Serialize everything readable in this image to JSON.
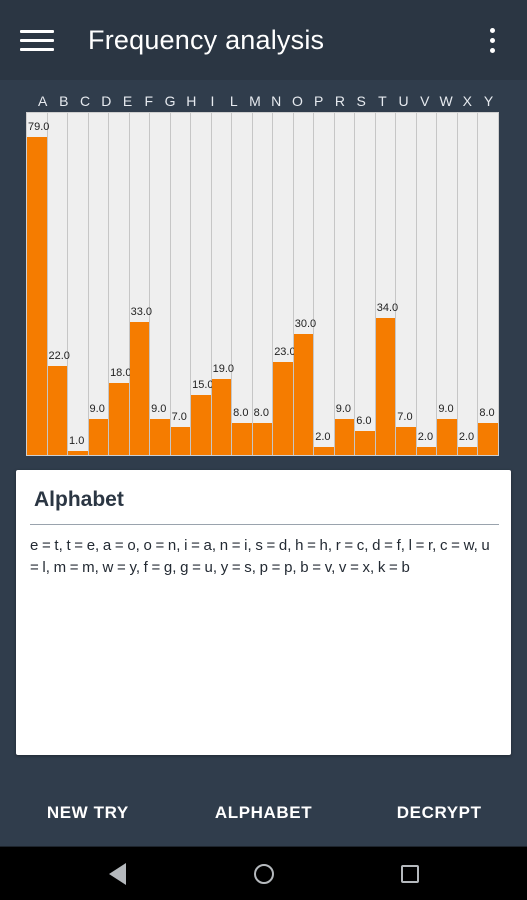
{
  "appbar": {
    "title": "Frequency analysis",
    "menu_icon": "hamburger-menu-icon",
    "overflow_icon": "more-vert-icon"
  },
  "chart_data": {
    "type": "bar",
    "title": "",
    "xlabel": "",
    "ylabel": "",
    "ylim": [
      0,
      79
    ],
    "grid": true,
    "legend": false,
    "categories": [
      "A",
      "B",
      "C",
      "D",
      "E",
      "F",
      "G",
      "H",
      "I",
      "L",
      "M",
      "N",
      "O",
      "P",
      "R",
      "S",
      "T",
      "U",
      "V",
      "W",
      "X",
      "Y"
    ],
    "values": [
      79.0,
      22.0,
      1.0,
      9.0,
      18.0,
      33.0,
      9.0,
      7.0,
      15.0,
      19.0,
      8.0,
      8.0,
      23.0,
      30.0,
      2.0,
      9.0,
      6.0,
      34.0,
      7.0,
      2.0,
      9.0,
      2.0
    ],
    "value_labels": [
      "79.0",
      "22.0",
      "1.0",
      "9.0",
      "18.0",
      "33.0",
      "9.0",
      "7.0",
      "15.0",
      "19.0",
      "8.0",
      "8.0",
      "23.0",
      "30.0",
      "2.0",
      "9.0",
      "6.0",
      "34.0",
      "7.0",
      "2.0",
      "9.0",
      "2.0"
    ],
    "trailing_value": 8.0,
    "trailing_value_label": "8.0",
    "bar_color": "#f57c00",
    "plot_background": "#efefef",
    "gridline_color": "#c6c6c6",
    "label_color": "#e6eaef"
  },
  "card": {
    "title": "Alphabet",
    "body": "e = t, t = e, a = o, o = n, i = a, n = i, s = d, h = h, r = c, d = f, l = r, c = w, u = l, m = m, w = y, f = g, g = u, y = s, p = p, b = v, v = x, k = b"
  },
  "buttons": [
    {
      "label": "NEW TRY",
      "name": "new-try-button"
    },
    {
      "label": "ALPHABET",
      "name": "alphabet-button"
    },
    {
      "label": "DECRYPT",
      "name": "decrypt-button"
    }
  ],
  "navbar": {
    "back": "back-triangle-icon",
    "home": "home-circle-icon",
    "recents": "recents-square-icon"
  },
  "theme": {
    "background": "#303d4c",
    "appbar": "#2b3643",
    "accent": "#f57c00",
    "card": "#ffffff",
    "text_light": "#ffffff"
  }
}
